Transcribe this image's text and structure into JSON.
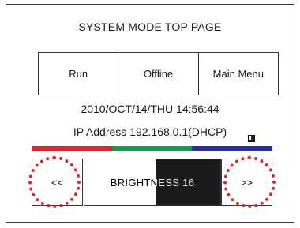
{
  "title": "SYSTEM MODE TOP PAGE",
  "menu": {
    "run": "Run",
    "offline": "Offline",
    "main_menu": "Main Menu"
  },
  "datetime": "2010/OCT/14/THU  14:56:44",
  "ip_text": "IP Address  192.168.0.1(DHCP)",
  "color_bar": [
    "#e3232b",
    "#1a9a4a",
    "#2b2f8f"
  ],
  "icons": {
    "battery": "battery-icon"
  },
  "nav": {
    "prev": "<<",
    "next": ">>"
  },
  "brightness": {
    "label": "BRIGHTNESS 16",
    "level": 16
  },
  "highlight_color": "#d42a2a"
}
